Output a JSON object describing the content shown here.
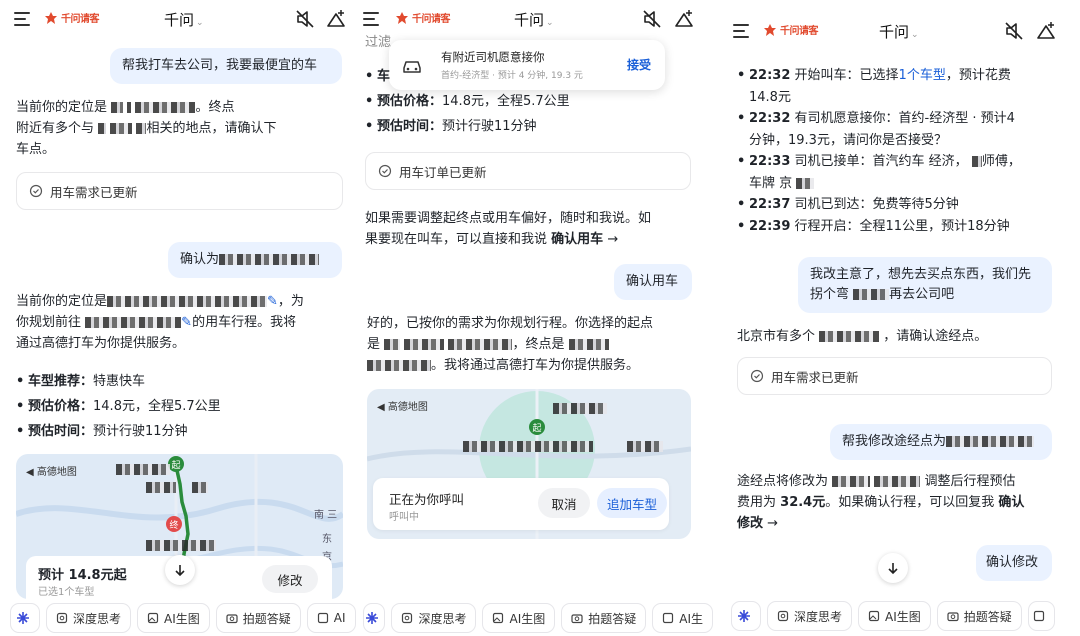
{
  "common": {
    "logo_text": "千问请客",
    "title": "千问",
    "chips": [
      "深度思考",
      "AI生图",
      "拍题答疑",
      "AI"
    ],
    "chips_p2": [
      "深度思考",
      "AI生图",
      "拍题答疑",
      "AI生"
    ]
  },
  "p1": {
    "user_msg_1": "帮我打车去公司，我要最便宜的车",
    "para1_a": "当前你的定位是",
    "para1_b": "。终点",
    "para1_c": "附近有多个与",
    "para1_d": "相关的地点，请确认下",
    "para1_e": "车点。",
    "card1": "用车需求已更新",
    "user_msg_2": "确认为",
    "para2_a": "当前你的定位是",
    "para2_b": "，为",
    "para2_c": "你规划前往",
    "para2_d": "的用车行程。我将",
    "para2_e": "通过高德打车为你提供服务。",
    "list": [
      {
        "k": "车型推荐：",
        "v": "特惠快车"
      },
      {
        "k": "预估价格：",
        "v": "14.8元，全程5.7公里"
      },
      {
        "k": "预估时间：",
        "v": "预计行驶11分钟"
      }
    ],
    "map_brand": "高德地图",
    "map_start": "起",
    "map_end": "终",
    "map_labels": [
      "南 三",
      "东",
      "京"
    ],
    "est_price": "预计 14.8元起",
    "est_sub": "已选1个车型",
    "modify_btn": "修改"
  },
  "p2": {
    "cut_top": "过滤",
    "notif_title": "有附近司机愿意接你",
    "notif_sub": "首约-经济型 · 预计 4 分钟, 19.3 元",
    "notif_accept": "接受",
    "list_cut": "车",
    "list": [
      {
        "k": "预估价格：",
        "v": "14.8元，全程5.7公里"
      },
      {
        "k": "预估时间：",
        "v": "预计行驶11分钟"
      }
    ],
    "card": "用车订单已更新",
    "para1_a": "如果需要调整起终点或用车偏好，随时和我说。如",
    "para1_b": "果要现在叫车，可以直接和我说",
    "para1_bold": "确认用车",
    "para1_arrow": "→",
    "user_msg": "确认用车",
    "para2_a": "好的，已按你的需求为你规划行程。你选择的起点",
    "para2_b": "是",
    "para2_c": "，终点是",
    "para2_d": "。我将通过高德打车为你提供服务。",
    "map_brand": "高德地图",
    "map_start": "起",
    "calling": "正在为你呼叫",
    "calling_sub": "呼叫中",
    "cancel": "取消",
    "add_car": "追加车型"
  },
  "p3": {
    "events": [
      {
        "t": "22:32",
        "v": "开始叫车：已选择",
        "link": "1个车型",
        "v2": "，预计花费",
        "l2": "14.8元"
      },
      {
        "t": "22:32",
        "v": "有司机愿意接你：首约-经济型 · 预计4",
        "l2": "分钟，19.3元，请问你是否接受？"
      },
      {
        "t": "22:33",
        "v": "司机已接单：首汽约车 经济，",
        "v3": "师傅，",
        "l2": "车牌 京"
      },
      {
        "t": "22:37",
        "v": "司机已到达：免费等待5分钟"
      },
      {
        "t": "22:39",
        "v": "行程开启：全程11公里，预计18分钟"
      }
    ],
    "user_msg_1a": "我改主意了，想先去买点东西，我们先",
    "user_msg_1b": "拐个弯",
    "user_msg_1c": "再去公司吧",
    "para1_a": "北京市有多个",
    "para1_b": "，请确认途经点。",
    "card": "用车需求已更新",
    "user_msg_2": "帮我修改途经点为",
    "para2_a": "途经点将修改为",
    "para2_b": "调整后行程预估",
    "para2_c": "费用为",
    "para2_price": "32.4元",
    "para2_d": "。如果确认行程，可以回复我",
    "para2_bold": "确认",
    "para2_e": "修改",
    "para2_arrow": "→",
    "confirm_btn": "确认修改"
  },
  "colors": {
    "accent": "#1a5fd8",
    "bubble": "#eaf2ff",
    "route": "#2a8c3c",
    "logo": "#e14a2e"
  }
}
